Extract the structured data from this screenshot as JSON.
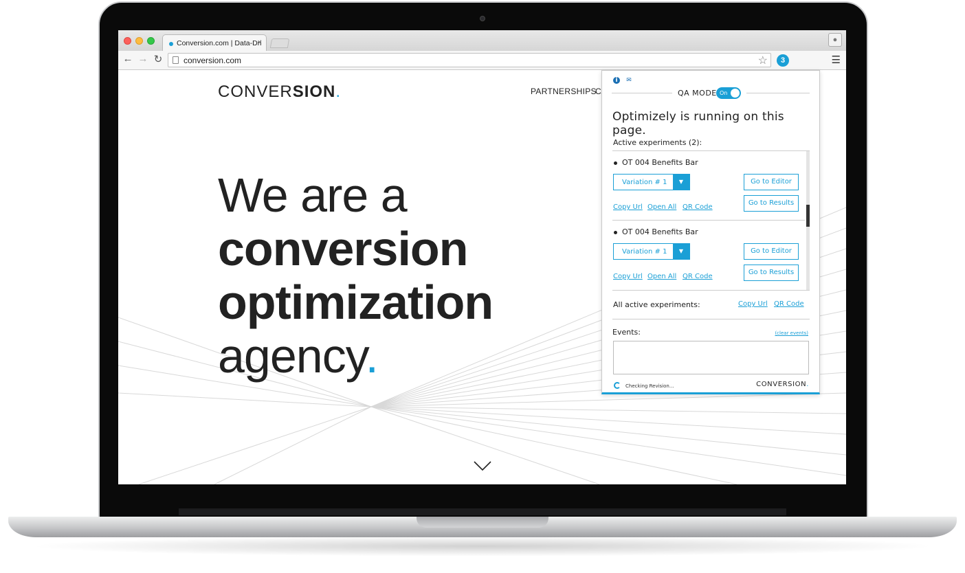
{
  "browser": {
    "tab_title": "Conversion.com | Data-Dri",
    "tab_close": "×",
    "url": "conversion.com",
    "extension_badge": "3"
  },
  "site": {
    "logo_regular": "CONVER",
    "logo_bold": "SION",
    "logo_dot": ".",
    "nav_partnerships": "PARTNERSHIPS",
    "nav_partial": "CA",
    "hero_line1": "We are a",
    "hero_line2": "conversion",
    "hero_line3": "optimization",
    "hero_line4": "agency",
    "hero_dot": "."
  },
  "popup": {
    "qa_mode_label": "QA MODE",
    "toggle_label": "On",
    "running_message": "Optimizely is running on this page.",
    "active_heading": "Active experiments (2):",
    "experiments": [
      {
        "name": "OT 004 Benefits Bar",
        "variation": "Variation # 1",
        "editor_label": "Go to Editor",
        "results_label": "Go to Results",
        "copy_url": "Copy Url",
        "open_all": "Open All",
        "qr_code": "QR Code"
      },
      {
        "name": "OT 004 Benefits Bar",
        "variation": "Variation # 1",
        "editor_label": "Go to Editor",
        "results_label": "Go to Results",
        "copy_url": "Copy Url",
        "open_all": "Open All",
        "qr_code": "QR Code"
      }
    ],
    "all_active_label": "All active experiments:",
    "all_copy_url": "Copy Url",
    "all_qr_code": "QR Code",
    "events_label": "Events:",
    "clear_events": "(clear events)",
    "status_text": "Checking Revision...",
    "brand_text": "CONVERSION",
    "brand_dot": "."
  },
  "colors": {
    "accent": "#1a9fd6",
    "text": "#222222"
  }
}
